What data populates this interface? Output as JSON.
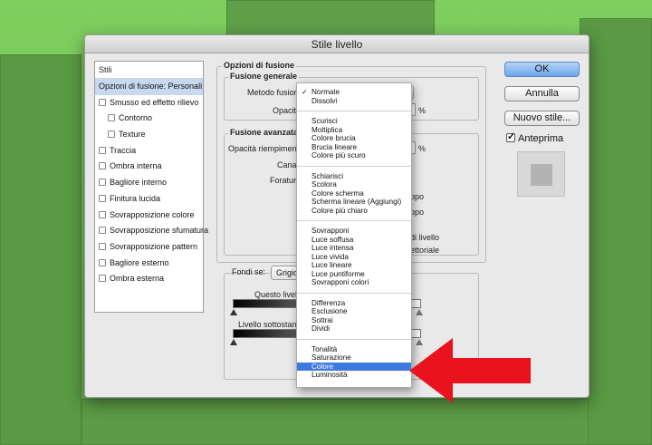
{
  "dialog": {
    "title": "Stile livello"
  },
  "styles_list": {
    "header": "Stili",
    "items": [
      {
        "label": "Opzioni di fusione: Personali",
        "checkbox": false,
        "selected": true,
        "indent": false
      },
      {
        "label": "Smusso ed effetto rilievo",
        "checkbox": true,
        "selected": false,
        "indent": false
      },
      {
        "label": "Contorno",
        "checkbox": true,
        "selected": false,
        "indent": true
      },
      {
        "label": "Texture",
        "checkbox": true,
        "selected": false,
        "indent": true
      },
      {
        "label": "Traccia",
        "checkbox": true,
        "selected": false,
        "indent": false
      },
      {
        "label": "Ombra interna",
        "checkbox": true,
        "selected": false,
        "indent": false
      },
      {
        "label": "Bagliore interno",
        "checkbox": true,
        "selected": false,
        "indent": false
      },
      {
        "label": "Finitura lucida",
        "checkbox": true,
        "selected": false,
        "indent": false
      },
      {
        "label": "Sovrapposizione colore",
        "checkbox": true,
        "selected": false,
        "indent": false
      },
      {
        "label": "Sovrapposizione sfumatura",
        "checkbox": true,
        "selected": false,
        "indent": false
      },
      {
        "label": "Sovrapposizione pattern",
        "checkbox": true,
        "selected": false,
        "indent": false
      },
      {
        "label": "Bagliore esterno",
        "checkbox": true,
        "selected": false,
        "indent": false
      },
      {
        "label": "Ombra esterna",
        "checkbox": true,
        "selected": false,
        "indent": false
      }
    ]
  },
  "blending": {
    "section_title": "Opzioni di fusione",
    "general": {
      "title": "Fusione generale",
      "mode_label": "Metodo fusione:",
      "opacity_label": "Opacità:",
      "opacity_unit": "%"
    },
    "advanced": {
      "title": "Fusione avanzata",
      "fill_opacity_label": "Opacità riempimento:",
      "fill_unit": "%",
      "channels_label": "Canali:",
      "knockout_label": "Foratura:",
      "peek_1": "ppo",
      "peek_2": "ppo",
      "peek_3": "di livello",
      "peek_4": "ettoriale"
    },
    "blend_if": {
      "label": "Fondi se:",
      "value": "Grigio",
      "this_layer": "Questo livello",
      "underlying_layer": "Livello sottostante"
    }
  },
  "buttons": {
    "ok": "OK",
    "cancel": "Annulla",
    "new_style": "Nuovo stile...",
    "preview": "Anteprima"
  },
  "blend_menu": {
    "check_mark": "✓",
    "groups": [
      [
        "Normale",
        "Dissolvi"
      ],
      [
        "Scurisci",
        "Moltiplica",
        "Colore brucia",
        "Brucia lineare",
        "Colore più scuro"
      ],
      [
        "Schiarisci",
        "Scolora",
        "Colore scherma",
        "Scherma lineare (Aggiungi)",
        "Colore più chiaro"
      ],
      [
        "Sovrapponi",
        "Luce soffusa",
        "Luce intensa",
        "Luce vivida",
        "Luce lineare",
        "Luce puntiforme",
        "Sovrapponi colori"
      ],
      [
        "Differenza",
        "Esclusione",
        "Sottrai",
        "Dividi"
      ],
      [
        "Tonalità",
        "Saturazione",
        "Colore",
        "Luminosità"
      ]
    ],
    "checked": "Normale",
    "highlighted": "Colore"
  },
  "colors": {
    "arrow": "#e8131c",
    "highlight": "#3d79e0",
    "background": "#6fbf53"
  }
}
